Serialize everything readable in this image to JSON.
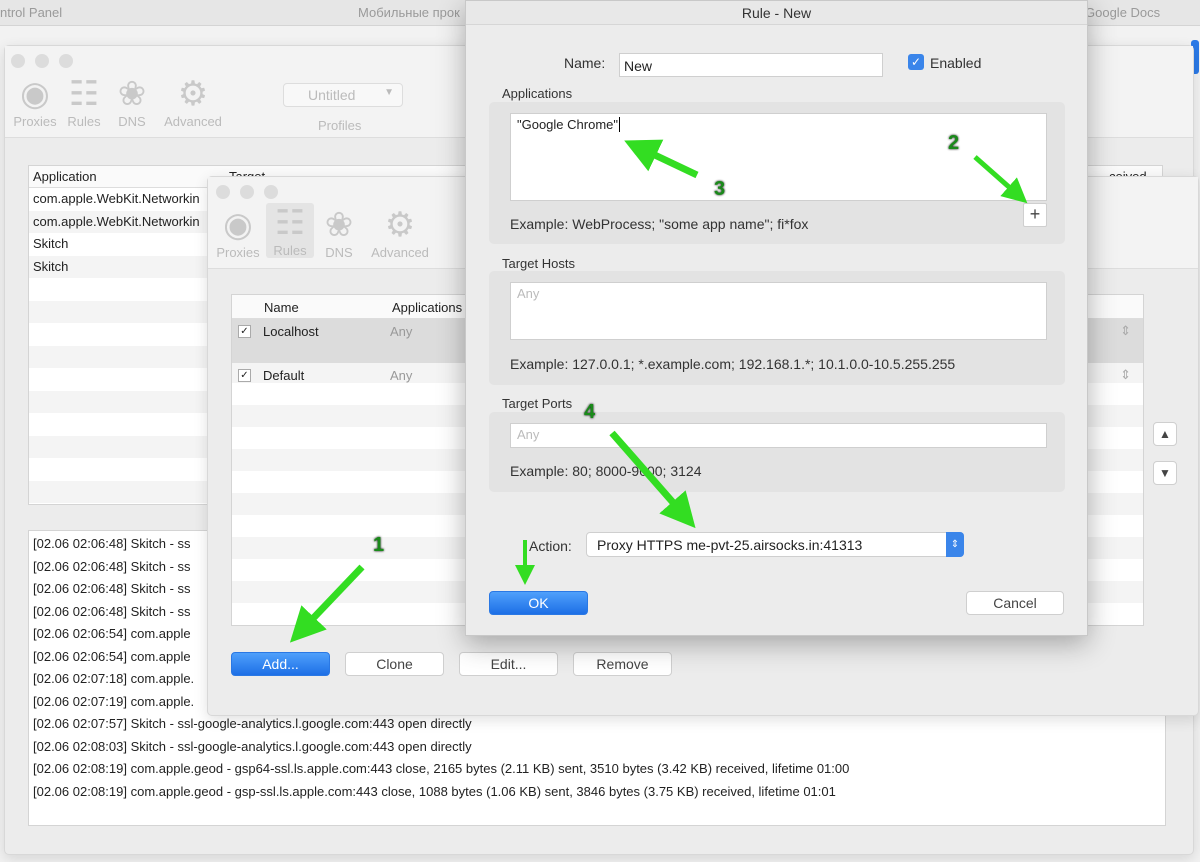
{
  "browser_tabs": [
    "ntrol Panel",
    "Мобильные прок",
    "Google Docs"
  ],
  "main_window": {
    "toolbar": [
      {
        "label": "Proxies",
        "icon": "globe-icon"
      },
      {
        "label": "Rules",
        "icon": "checklist-icon"
      },
      {
        "label": "DNS",
        "icon": "dns-icon"
      },
      {
        "label": "Advanced",
        "icon": "gear-icon"
      }
    ],
    "profile_select": "Untitled",
    "profiles_label": "Profiles",
    "table_headers": [
      "Application",
      "Target",
      "ceived"
    ],
    "rows": [
      "com.apple.WebKit.Networkin",
      "com.apple.WebKit.Networkin",
      "Skitch",
      "Skitch"
    ],
    "log": [
      "[02.06 02:06:48] Skitch - ss",
      "[02.06 02:06:48] Skitch - ss",
      "[02.06 02:06:48] Skitch - ss",
      "[02.06 02:06:48] Skitch - ss",
      "[02.06 02:06:54] com.apple",
      "[02.06 02:06:54] com.apple",
      "[02.06 02:07:18] com.apple.",
      "[02.06 02:07:19] com.apple.",
      "[02.06 02:07:57] Skitch - ssl-google-analytics.l.google.com:443 open directly",
      "[02.06 02:08:03] Skitch - ssl-google-analytics.l.google.com:443 open directly",
      "[02.06 02:08:19] com.apple.geod - gsp64-ssl.ls.apple.com:443 close, 2165 bytes (2.11 KB) sent, 3510 bytes (3.42 KB) received, lifetime 01:00",
      "[02.06 02:08:19] com.apple.geod - gsp-ssl.ls.apple.com:443 close, 1088 bytes (1.06 KB) sent, 3846 bytes (3.75 KB) received, lifetime 01:01"
    ]
  },
  "rules_window": {
    "toolbar": [
      {
        "label": "Proxies",
        "icon": "globe-icon"
      },
      {
        "label": "Rules",
        "icon": "checklist-icon"
      },
      {
        "label": "DNS",
        "icon": "dns-icon"
      },
      {
        "label": "Advanced",
        "icon": "gear-icon"
      }
    ],
    "headers": [
      "Name",
      "Applications"
    ],
    "rules": [
      {
        "name": "Localhost",
        "apps": "Any",
        "checked": true
      },
      {
        "name": "Default",
        "apps": "Any",
        "checked": true
      }
    ],
    "buttons": {
      "add": "Add...",
      "clone": "Clone",
      "edit": "Edit...",
      "remove": "Remove"
    }
  },
  "dialog": {
    "title": "Rule - New",
    "name_label": "Name:",
    "name_value": "New",
    "enabled_label": "Enabled",
    "enabled": true,
    "applications_label": "Applications",
    "applications_value": "\"Google Chrome\"",
    "applications_example": "Example: WebProcess; \"some app name\"; fi*fox",
    "hosts_label": "Target Hosts",
    "hosts_placeholder": "Any",
    "hosts_example": "Example: 127.0.0.1; *.example.com; 192.168.1.*; 10.1.0.0-10.5.255.255",
    "ports_label": "Target Ports",
    "ports_placeholder": "Any",
    "ports_example": "Example: 80; 8000-9000; 3124",
    "action_label": "Action:",
    "action_value": "Proxy HTTPS me-pvt-25.airsocks.in:41313",
    "ok": "OK",
    "cancel": "Cancel",
    "plus": "+"
  },
  "annotations": [
    "1",
    "2",
    "3",
    "4"
  ],
  "colors": {
    "accent": "#1d6fe6",
    "arrow": "#33dd22"
  }
}
